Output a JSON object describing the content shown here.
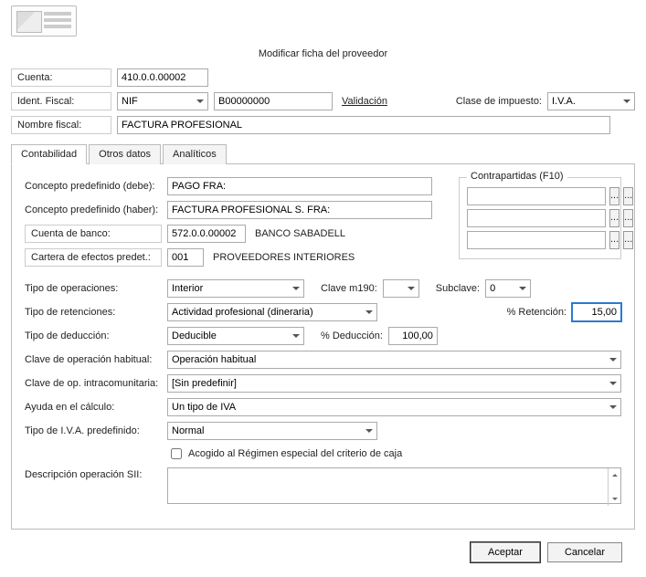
{
  "title": "Modificar ficha del proveedor",
  "header": {
    "cuenta_label": "Cuenta:",
    "cuenta_value": "410.0.0.00002",
    "ident_label": "Ident. Fiscal:",
    "ident_type": "NIF",
    "ident_value": "B00000000",
    "validacion": "Validación",
    "clase_imp_label": "Clase de impuesto:",
    "clase_imp_value": "I.V.A.",
    "nombre_label": "Nombre fiscal:",
    "nombre_value": "FACTURA PROFESIONAL"
  },
  "tabs": {
    "contabilidad": "Contabilidad",
    "otros": "Otros datos",
    "analiticos": "Analíticos"
  },
  "form": {
    "concepto_debe_label": "Concepto predefinido (debe):",
    "concepto_debe_value": "PAGO FRA:",
    "concepto_haber_label": "Concepto predefinido (haber):",
    "concepto_haber_value": "FACTURA PROFESIONAL S. FRA:",
    "cuenta_banco_label": "Cuenta de banco:",
    "cuenta_banco_code": "572.0.0.00002",
    "cuenta_banco_name": "BANCO SABADELL",
    "cartera_label": "Cartera de efectos predet.:",
    "cartera_code": "001",
    "cartera_name": "PROVEEDORES INTERIORES",
    "tipo_op_label": "Tipo de operaciones:",
    "tipo_op_value": "Interior",
    "clave_m190_label": "Clave m190:",
    "clave_m190_value": "",
    "subclave_label": "Subclave:",
    "subclave_value": "0",
    "tipo_ret_label": "Tipo de retenciones:",
    "tipo_ret_value": "Actividad profesional (dineraria)",
    "pct_ret_label": "% Retención:",
    "pct_ret_value": "15,00",
    "tipo_ded_label": "Tipo de deducción:",
    "tipo_ded_value": "Deducible",
    "pct_ded_label": "% Deducción:",
    "pct_ded_value": "100,00",
    "clave_hab_label": "Clave de operación habitual:",
    "clave_hab_value": "Operación habitual",
    "clave_intra_label": "Clave de op. intracomunitaria:",
    "clave_intra_value": "[Sin predefinir]",
    "ayuda_label": "Ayuda en el cálculo:",
    "ayuda_value": "Un tipo de IVA",
    "tipo_iva_label": "Tipo de I.V.A. predefinido:",
    "tipo_iva_value": "Normal",
    "acogido_label": "Acogido al Régimen especial del criterio de caja",
    "desc_sii_label": "Descripción operación SII:",
    "desc_sii_value": ""
  },
  "contrapartidas": {
    "title": "Contrapartidas (F10)",
    "ellipsis": "..."
  },
  "footer": {
    "aceptar": "Aceptar",
    "cancelar": "Cancelar"
  }
}
